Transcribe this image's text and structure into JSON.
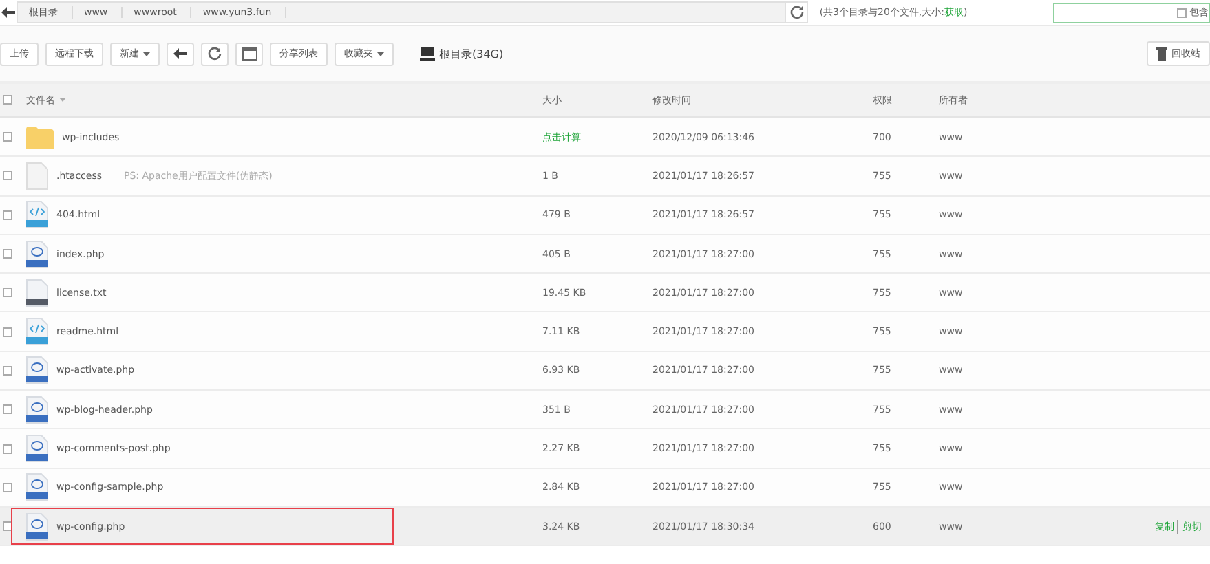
{
  "path_bar": {
    "crumbs": [
      "根目录",
      "www",
      "wwwroot",
      "www.yun3.fun"
    ],
    "summary": "(共3个目录与20个文件,大小:",
    "summary_link": "获取",
    "summary_end": ")",
    "search_option": {
      "label": "包含",
      "checked": false
    }
  },
  "toolbar": {
    "buttons": [
      {
        "kind": "text",
        "label": "上传"
      },
      {
        "kind": "text",
        "label": "远程下载"
      },
      {
        "kind": "dropdown",
        "label": "新建"
      },
      {
        "kind": "back"
      },
      {
        "kind": "refresh"
      },
      {
        "kind": "terminal"
      },
      {
        "kind": "text",
        "label": "分享列表"
      },
      {
        "kind": "dropdown",
        "label": "收藏夹"
      }
    ],
    "disk": "根目录(34G)",
    "recycle": "回收站"
  },
  "table": {
    "select_all": {
      "checked": false
    },
    "columns": [
      "文件名",
      "大小",
      "修改时间",
      "权限",
      "所有者"
    ],
    "rows": [
      {
        "kind": "folder",
        "name": "wp-includes",
        "size": "点击计算",
        "size_link": true,
        "time": "2020/12/09 06:13:46",
        "perm": "700",
        "owner": "www",
        "checked": false,
        "selected": false
      },
      {
        "kind": "blank",
        "name": ".htaccess",
        "note": "PS: Apache用户配置文件(伪静态)",
        "size": "1 B",
        "time": "2021/01/17 18:26:57",
        "perm": "755",
        "owner": "www",
        "checked": false,
        "selected": false
      },
      {
        "kind": "html",
        "name": "404.html",
        "size": "479 B",
        "time": "2021/01/17 18:26:57",
        "perm": "755",
        "owner": "www",
        "checked": false,
        "selected": false
      },
      {
        "kind": "php",
        "name": "index.php",
        "size": "405 B",
        "time": "2021/01/17 18:27:00",
        "perm": "755",
        "owner": "www",
        "checked": false,
        "selected": false
      },
      {
        "kind": "txt",
        "name": "license.txt",
        "size": "19.45 KB",
        "time": "2021/01/17 18:27:00",
        "perm": "755",
        "owner": "www",
        "checked": false,
        "selected": false
      },
      {
        "kind": "html",
        "name": "readme.html",
        "size": "7.11 KB",
        "time": "2021/01/17 18:27:00",
        "perm": "755",
        "owner": "www",
        "checked": false,
        "selected": false
      },
      {
        "kind": "php",
        "name": "wp-activate.php",
        "size": "6.93 KB",
        "time": "2021/01/17 18:27:00",
        "perm": "755",
        "owner": "www",
        "checked": false,
        "selected": false
      },
      {
        "kind": "php",
        "name": "wp-blog-header.php",
        "size": "351 B",
        "time": "2021/01/17 18:27:00",
        "perm": "755",
        "owner": "www",
        "checked": false,
        "selected": false
      },
      {
        "kind": "php",
        "name": "wp-comments-post.php",
        "size": "2.27 KB",
        "time": "2021/01/17 18:27:00",
        "perm": "755",
        "owner": "www",
        "checked": false,
        "selected": false
      },
      {
        "kind": "php",
        "name": "wp-config-sample.php",
        "size": "2.84 KB",
        "time": "2021/01/17 18:27:00",
        "perm": "755",
        "owner": "www",
        "checked": false,
        "selected": false
      },
      {
        "kind": "php",
        "name": "wp-config.php",
        "size": "3.24 KB",
        "time": "2021/01/17 18:30:34",
        "perm": "600",
        "owner": "www",
        "checked": false,
        "selected": true,
        "actions": [
          "复制",
          "剪切"
        ]
      }
    ]
  }
}
